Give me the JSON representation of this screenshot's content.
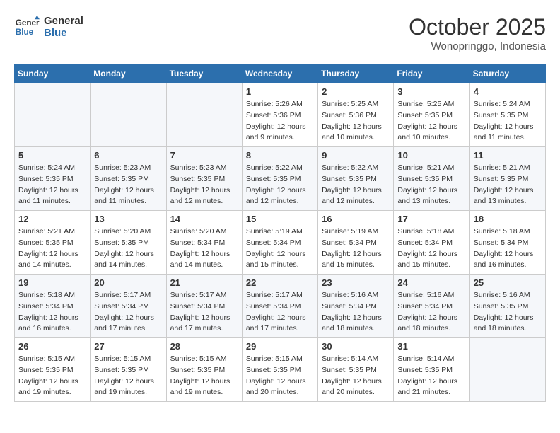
{
  "header": {
    "logo_line1": "General",
    "logo_line2": "Blue",
    "month": "October 2025",
    "location": "Wonopringgo, Indonesia"
  },
  "weekdays": [
    "Sunday",
    "Monday",
    "Tuesday",
    "Wednesday",
    "Thursday",
    "Friday",
    "Saturday"
  ],
  "weeks": [
    [
      {
        "day": "",
        "info": ""
      },
      {
        "day": "",
        "info": ""
      },
      {
        "day": "",
        "info": ""
      },
      {
        "day": "1",
        "info": "Sunrise: 5:26 AM\nSunset: 5:36 PM\nDaylight: 12 hours\nand 9 minutes."
      },
      {
        "day": "2",
        "info": "Sunrise: 5:25 AM\nSunset: 5:36 PM\nDaylight: 12 hours\nand 10 minutes."
      },
      {
        "day": "3",
        "info": "Sunrise: 5:25 AM\nSunset: 5:35 PM\nDaylight: 12 hours\nand 10 minutes."
      },
      {
        "day": "4",
        "info": "Sunrise: 5:24 AM\nSunset: 5:35 PM\nDaylight: 12 hours\nand 11 minutes."
      }
    ],
    [
      {
        "day": "5",
        "info": "Sunrise: 5:24 AM\nSunset: 5:35 PM\nDaylight: 12 hours\nand 11 minutes."
      },
      {
        "day": "6",
        "info": "Sunrise: 5:23 AM\nSunset: 5:35 PM\nDaylight: 12 hours\nand 11 minutes."
      },
      {
        "day": "7",
        "info": "Sunrise: 5:23 AM\nSunset: 5:35 PM\nDaylight: 12 hours\nand 12 minutes."
      },
      {
        "day": "8",
        "info": "Sunrise: 5:22 AM\nSunset: 5:35 PM\nDaylight: 12 hours\nand 12 minutes."
      },
      {
        "day": "9",
        "info": "Sunrise: 5:22 AM\nSunset: 5:35 PM\nDaylight: 12 hours\nand 12 minutes."
      },
      {
        "day": "10",
        "info": "Sunrise: 5:21 AM\nSunset: 5:35 PM\nDaylight: 12 hours\nand 13 minutes."
      },
      {
        "day": "11",
        "info": "Sunrise: 5:21 AM\nSunset: 5:35 PM\nDaylight: 12 hours\nand 13 minutes."
      }
    ],
    [
      {
        "day": "12",
        "info": "Sunrise: 5:21 AM\nSunset: 5:35 PM\nDaylight: 12 hours\nand 14 minutes."
      },
      {
        "day": "13",
        "info": "Sunrise: 5:20 AM\nSunset: 5:35 PM\nDaylight: 12 hours\nand 14 minutes."
      },
      {
        "day": "14",
        "info": "Sunrise: 5:20 AM\nSunset: 5:34 PM\nDaylight: 12 hours\nand 14 minutes."
      },
      {
        "day": "15",
        "info": "Sunrise: 5:19 AM\nSunset: 5:34 PM\nDaylight: 12 hours\nand 15 minutes."
      },
      {
        "day": "16",
        "info": "Sunrise: 5:19 AM\nSunset: 5:34 PM\nDaylight: 12 hours\nand 15 minutes."
      },
      {
        "day": "17",
        "info": "Sunrise: 5:18 AM\nSunset: 5:34 PM\nDaylight: 12 hours\nand 15 minutes."
      },
      {
        "day": "18",
        "info": "Sunrise: 5:18 AM\nSunset: 5:34 PM\nDaylight: 12 hours\nand 16 minutes."
      }
    ],
    [
      {
        "day": "19",
        "info": "Sunrise: 5:18 AM\nSunset: 5:34 PM\nDaylight: 12 hours\nand 16 minutes."
      },
      {
        "day": "20",
        "info": "Sunrise: 5:17 AM\nSunset: 5:34 PM\nDaylight: 12 hours\nand 17 minutes."
      },
      {
        "day": "21",
        "info": "Sunrise: 5:17 AM\nSunset: 5:34 PM\nDaylight: 12 hours\nand 17 minutes."
      },
      {
        "day": "22",
        "info": "Sunrise: 5:17 AM\nSunset: 5:34 PM\nDaylight: 12 hours\nand 17 minutes."
      },
      {
        "day": "23",
        "info": "Sunrise: 5:16 AM\nSunset: 5:34 PM\nDaylight: 12 hours\nand 18 minutes."
      },
      {
        "day": "24",
        "info": "Sunrise: 5:16 AM\nSunset: 5:34 PM\nDaylight: 12 hours\nand 18 minutes."
      },
      {
        "day": "25",
        "info": "Sunrise: 5:16 AM\nSunset: 5:35 PM\nDaylight: 12 hours\nand 18 minutes."
      }
    ],
    [
      {
        "day": "26",
        "info": "Sunrise: 5:15 AM\nSunset: 5:35 PM\nDaylight: 12 hours\nand 19 minutes."
      },
      {
        "day": "27",
        "info": "Sunrise: 5:15 AM\nSunset: 5:35 PM\nDaylight: 12 hours\nand 19 minutes."
      },
      {
        "day": "28",
        "info": "Sunrise: 5:15 AM\nSunset: 5:35 PM\nDaylight: 12 hours\nand 19 minutes."
      },
      {
        "day": "29",
        "info": "Sunrise: 5:15 AM\nSunset: 5:35 PM\nDaylight: 12 hours\nand 20 minutes."
      },
      {
        "day": "30",
        "info": "Sunrise: 5:14 AM\nSunset: 5:35 PM\nDaylight: 12 hours\nand 20 minutes."
      },
      {
        "day": "31",
        "info": "Sunrise: 5:14 AM\nSunset: 5:35 PM\nDaylight: 12 hours\nand 21 minutes."
      },
      {
        "day": "",
        "info": ""
      }
    ]
  ]
}
